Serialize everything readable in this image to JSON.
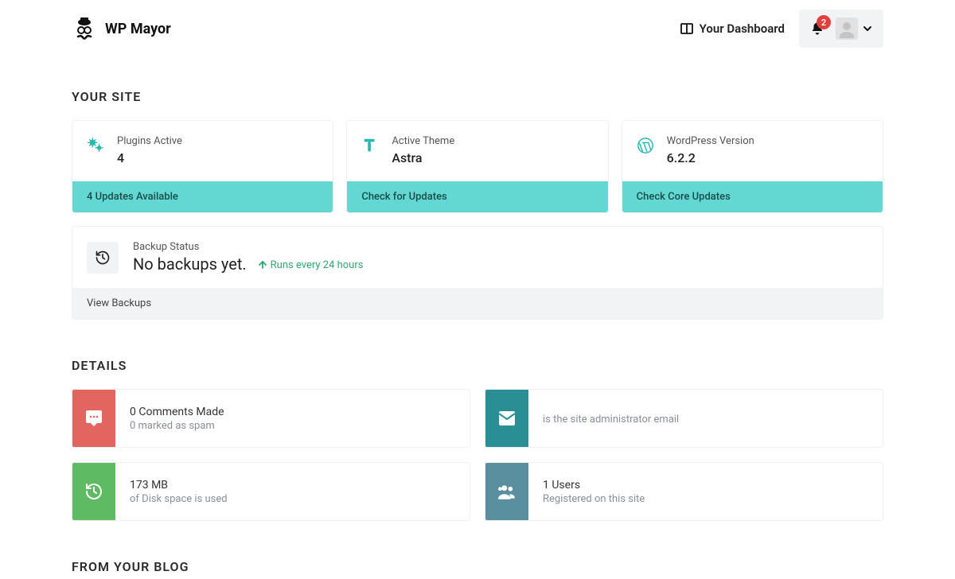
{
  "header": {
    "brand": "WP Mayor",
    "dashboard_label": "Your Dashboard",
    "notification_count": "2"
  },
  "sections": {
    "site": "YOUR SITE",
    "details": "DETAILS",
    "blog": "FROM YOUR BLOG"
  },
  "site_cards": {
    "plugins": {
      "label": "Plugins Active",
      "value": "4",
      "footer": "4 Updates Available"
    },
    "theme": {
      "label": "Active Theme",
      "value": "Astra",
      "footer": "Check for Updates"
    },
    "wp": {
      "label": "WordPress Version",
      "value": "6.2.2",
      "footer": "Check Core Updates"
    }
  },
  "backup": {
    "label": "Backup Status",
    "status": "No backups yet.",
    "schedule": "Runs every 24 hours",
    "footer": "View Backups"
  },
  "details": {
    "comments": {
      "line1": "0 Comments Made",
      "line2": "0 marked as spam"
    },
    "email": {
      "line1": "",
      "line2": "is the site administrator email"
    },
    "disk": {
      "line1": "173 MB",
      "line2": "of Disk space is used"
    },
    "users": {
      "line1": "1 Users",
      "line2": "Registered on this site"
    }
  }
}
